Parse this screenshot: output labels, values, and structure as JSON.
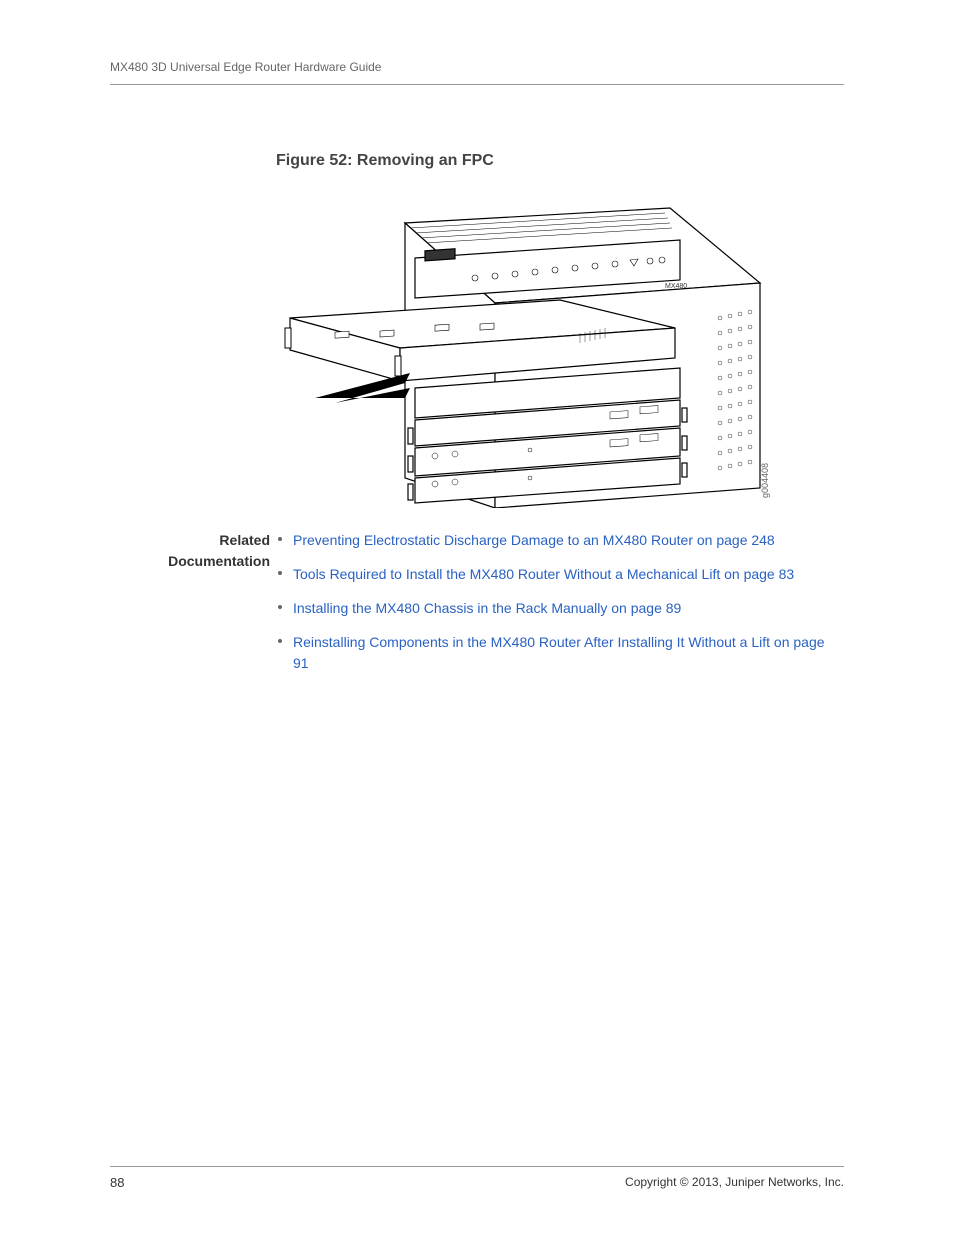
{
  "header": {
    "title": "MX480 3D Universal Edge Router Hardware Guide"
  },
  "figure": {
    "caption": "Figure 52: Removing an FPC",
    "image_label": "g004408"
  },
  "related": {
    "heading_line1": "Related",
    "heading_line2": "Documentation",
    "items": [
      {
        "text": "Preventing Electrostatic Discharge Damage to an MX480 Router on page 248"
      },
      {
        "text": "Tools Required to Install the MX480 Router Without a Mechanical Lift on page 83"
      },
      {
        "text": "Installing the MX480 Chassis in the Rack Manually on page 89"
      },
      {
        "text": "Reinstalling Components in the MX480 Router After Installing It Without a Lift on page 91"
      }
    ]
  },
  "footer": {
    "page_number": "88",
    "copyright": "Copyright © 2013, Juniper Networks, Inc."
  }
}
